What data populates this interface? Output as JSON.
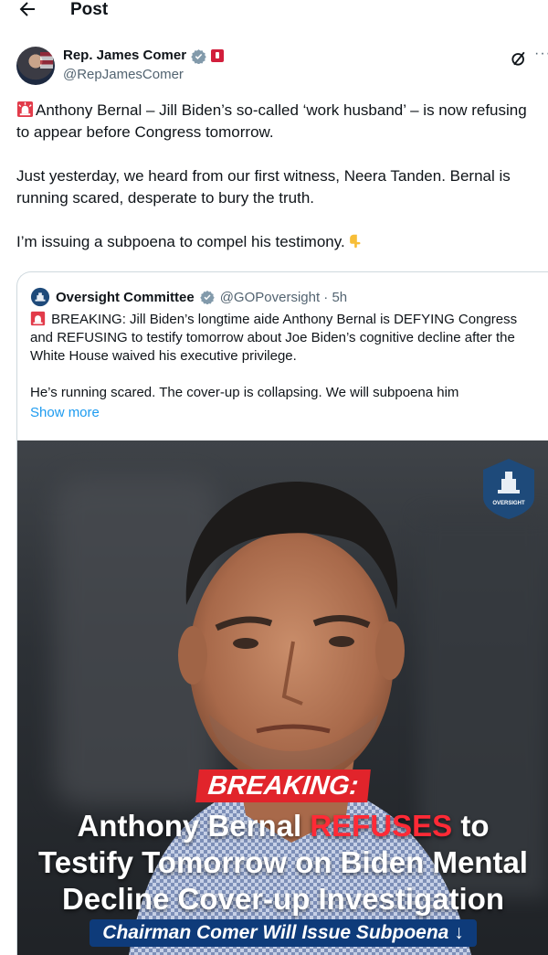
{
  "topbar": {
    "title": "Post"
  },
  "author": {
    "name": "Rep. James Comer",
    "handle": "@RepJamesComer"
  },
  "tweet": {
    "para1": "Anthony Bernal – Jill Biden’s so-called ‘work husband’ – is now refusing to appear before Congress tomorrow.",
    "para2": "Just yesterday, we heard from our first witness, Neera Tanden. Bernal is running scared, desperate to bury the truth.",
    "para3": "I’m issuing a subpoena to compel his testimony."
  },
  "quote": {
    "name": "Oversight Committee",
    "handle": "@GOPoversight · 5h",
    "text1": "BREAKING: Jill Biden’s longtime aide Anthony Bernal is DEFYING Congress and REFUSING to testify tomorrow about Joe Biden’s cognitive decline after the White House waived his executive privilege.",
    "text2": "He’s running scared. The cover-up is collapsing. We will subpoena him",
    "show_more": "Show more"
  },
  "image": {
    "breaking": "BREAKING:",
    "headline_a": "Anthony Bernal ",
    "headline_red": "REFUSES",
    "headline_b": " to",
    "headline_line2": "Testify Tomorrow on Biden Mental",
    "headline_line3": "Decline Cover-up Investigation",
    "subbar": "Chairman Comer Will Issue Subpoena ↓",
    "seal_text": "OVERSIGHT"
  },
  "colors": {
    "link": "#1d9bf0",
    "verified": "#829aab",
    "breaking_red": "#e1242b",
    "subbar_blue": "#0e3b7a"
  },
  "icons": [
    "back-arrow-icon",
    "verified-icon",
    "flag-badge-icon",
    "grok-icon",
    "more-icon",
    "siren-icon",
    "pointing-down-icon",
    "oversight-logo-icon"
  ]
}
